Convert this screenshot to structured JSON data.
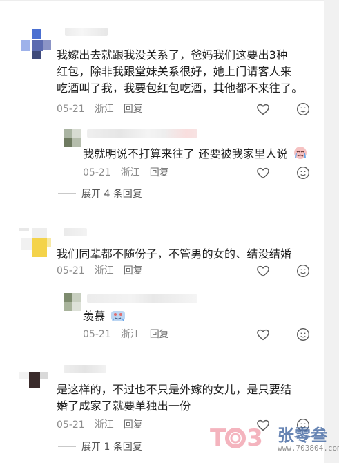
{
  "comments": [
    {
      "text": "我嫁出去就跟我没关系了，爸妈我们这要出3种红包，除非我跟堂妹关系很好，她上门请客人来吃酒叫了我，我要包红包吃酒，其他都不来往了。",
      "lines": [
        "我嫁出去就跟我没关系了，爸妈我们这要出3种",
        "红包，除非我跟堂妹关系很好，她上门请客人来",
        "吃酒叫了我，我要包红包吃酒，其他都不来往了。"
      ],
      "date": "05-21",
      "location": "浙江",
      "reply_label": "回复",
      "replies": [
        {
          "text": "我就明说不打算来往了 还要被我家里人说",
          "date": "05-21",
          "location": "浙江",
          "reply_label": "回复"
        }
      ],
      "expand_label": "展开 4 条回复"
    },
    {
      "text": "我们同辈都不随份子，不管男的女的、结没结婚",
      "lines": [
        "我们同辈都不随份子，不管男的女的、结没结婚"
      ],
      "date": "05-21",
      "location": "浙江",
      "reply_label": "回复",
      "replies": [
        {
          "text": "羡慕",
          "date": "05-21",
          "location": "浙江",
          "reply_label": "回复"
        }
      ]
    },
    {
      "text": "是这样的，不过也不只是外嫁的女儿，是只要结婚了成家了就要单独出一份",
      "lines": [
        "是这样的，不过也不只是外嫁的女儿，是只要结",
        "婚了成家了就要单独出一份"
      ],
      "date": "05-21",
      "location": "浙江",
      "reply_label": "回复",
      "expand_label": "展开 1 条回复"
    }
  ],
  "icons": {
    "like": "heart-outline-icon",
    "emoji": "smile-face-icon"
  },
  "watermark": {
    "logo": "TO3",
    "title": "张零叁",
    "url": "www.703804.com"
  },
  "colors": {
    "text": "#1e1e1e",
    "meta": "#8c8c8c",
    "icon": "#5a5a5a",
    "watermark_pink": "#f3a7b3",
    "watermark_blue": "#4c6fa6"
  }
}
